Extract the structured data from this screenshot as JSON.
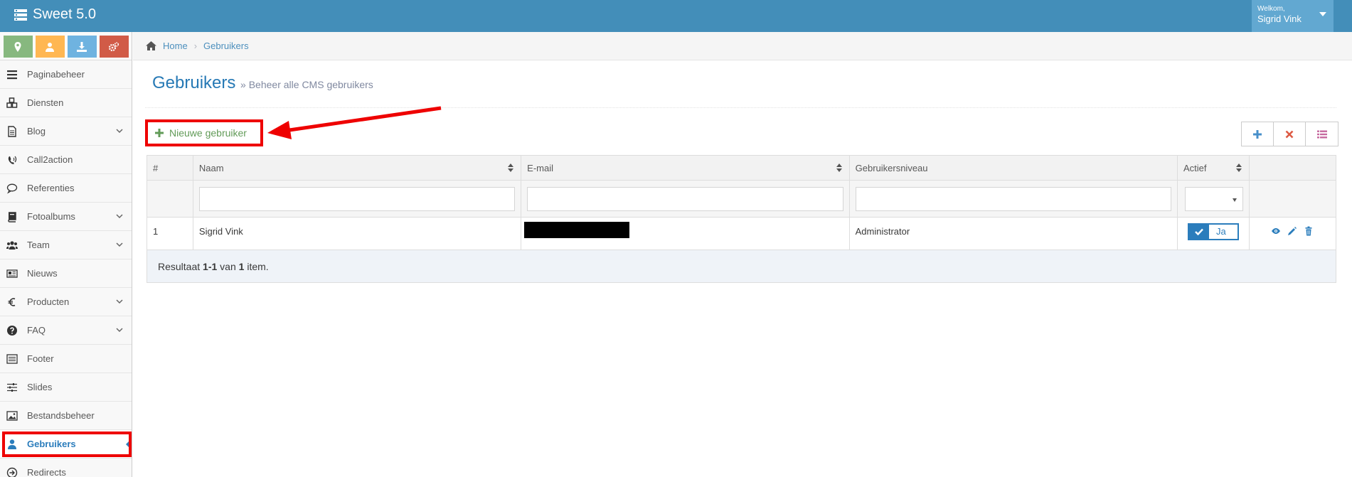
{
  "app": {
    "title": "Sweet 5.0"
  },
  "user": {
    "welcome": "Welkom,",
    "name": "Sigrid Vink"
  },
  "shortcuts": [
    {
      "icon": "map-marker-icon",
      "color": "#87b87f"
    },
    {
      "icon": "user-icon",
      "color": "#ffb752"
    },
    {
      "icon": "download-icon",
      "color": "#6fb3e0"
    },
    {
      "icon": "cogs-icon",
      "color": "#d15b47"
    }
  ],
  "sidebar": {
    "items": [
      {
        "label": "Paginabeheer",
        "icon": "bars-icon"
      },
      {
        "label": "Diensten",
        "icon": "cubes-icon"
      },
      {
        "label": "Blog",
        "icon": "file-text-icon"
      },
      {
        "label": "Call2action",
        "icon": "volume-control-phone-icon"
      },
      {
        "label": "Referenties",
        "icon": "comment-icon"
      },
      {
        "label": "Fotoalbums",
        "icon": "book-icon"
      },
      {
        "label": "Team",
        "icon": "users-icon"
      },
      {
        "label": "Nieuws",
        "icon": "newspaper-icon"
      },
      {
        "label": "Producten",
        "icon": "euro-icon"
      },
      {
        "label": "FAQ",
        "icon": "question-circle-icon"
      },
      {
        "label": "Footer",
        "icon": "list-alt-icon"
      },
      {
        "label": "Slides",
        "icon": "sliders-icon"
      },
      {
        "label": "Bestandsbeheer",
        "icon": "image-icon"
      },
      {
        "label": "Gebruikers",
        "icon": "user-icon"
      },
      {
        "label": "Redirects",
        "icon": "arrow-circle-right-icon"
      }
    ]
  },
  "breadcrumb": {
    "home": "Home",
    "current": "Gebruikers"
  },
  "page": {
    "title": "Gebruikers",
    "subtitle": "» Beheer alle CMS gebruikers"
  },
  "toolbar": {
    "new_user_label": "Nieuwe gebruiker"
  },
  "table": {
    "columns": [
      "#",
      "Naam",
      "E-mail",
      "Gebruikersniveau",
      "Actief",
      ""
    ],
    "rows": [
      {
        "num": "1",
        "name": "Sigrid Vink",
        "email": "",
        "level": "Administrator",
        "active": "Ja"
      }
    ],
    "footer": {
      "prefix": "Resultaat ",
      "range": "1-1",
      "mid": " van ",
      "total": "1",
      "suffix": " item."
    }
  },
  "colors": {
    "accent": "#438eb9",
    "link": "#2b7dbc",
    "annotation": "#ee0000"
  }
}
